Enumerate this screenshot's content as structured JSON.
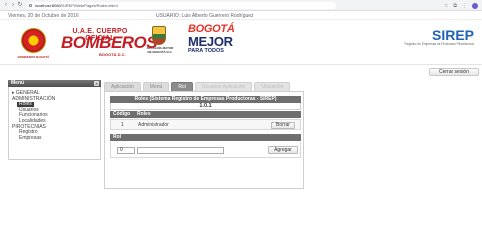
{
  "browser": {
    "url_host": "localhost:8080",
    "url_path": "/SIREP/Web/Pages/Roles.xhtml",
    "icons": [
      "back-icon",
      "forward-icon",
      "reload-icon",
      "lock-icon",
      "star-icon",
      "extension-icon",
      "profile-icon"
    ]
  },
  "infobar": {
    "date": "Viernes, 20 de Octubre de 2016",
    "user": "USUARIO: Luis Alberto Guerrero Rodríguez"
  },
  "header": {
    "bomberos_line1": "U.A.E. CUERPO OFICIAL",
    "bomberos_line2": "BOMBEROS",
    "bomberos_line3": "BOGOTÁ D.C.",
    "seal_caption": "BOMBEROS BOGOTÁ",
    "alcaldia_text": "ALCALDÍA MAYOR DE BOGOTÁ D.C.",
    "bogota_line1": "BOGOTÁ",
    "bogota_line2": "MEJOR",
    "bogota_line3": "PARA TODOS",
    "sirep_title": "SIREP",
    "sirep_subtitle": "Registro de Empresas de Productos Pirotécnicos",
    "logout_label": "Cerrar sesión"
  },
  "sidebar": {
    "title": "Menú",
    "close_glyph": "×",
    "items": [
      {
        "label": "▸ GENERAL",
        "level": 1
      },
      {
        "label": "ADMINISTRACIÓN",
        "level": 1
      },
      {
        "label": "Roles",
        "level": 2,
        "selected": true
      },
      {
        "label": "Usuarios",
        "level": 2
      },
      {
        "label": "Funcionarios",
        "level": 2
      },
      {
        "label": "Localidades",
        "level": 2
      },
      {
        "label": "PIROTECNIAS",
        "level": 1
      },
      {
        "label": "Registro",
        "level": 2
      },
      {
        "label": "Empresas",
        "level": 2
      }
    ]
  },
  "tabs": [
    {
      "label": "Aplicación",
      "state": "normal"
    },
    {
      "label": "Menú",
      "state": "normal"
    },
    {
      "label": "Rol",
      "state": "active"
    },
    {
      "label": "Usuarios Aplicación",
      "state": "dim"
    },
    {
      "label": "Ubicación",
      "state": "dim"
    }
  ],
  "roles_table": {
    "title": "Roles (Sistema Registro de Empresas Productoras - SIREP)",
    "subtitle": "1.0.1",
    "columns": [
      "Código",
      "Roles"
    ],
    "rows": [
      {
        "code": "1",
        "name": "Administrador",
        "action_label": "Borrar"
      }
    ]
  },
  "rol_form": {
    "header": "Rol",
    "code_value": "0",
    "name_value": "",
    "add_label": "Agregar"
  }
}
